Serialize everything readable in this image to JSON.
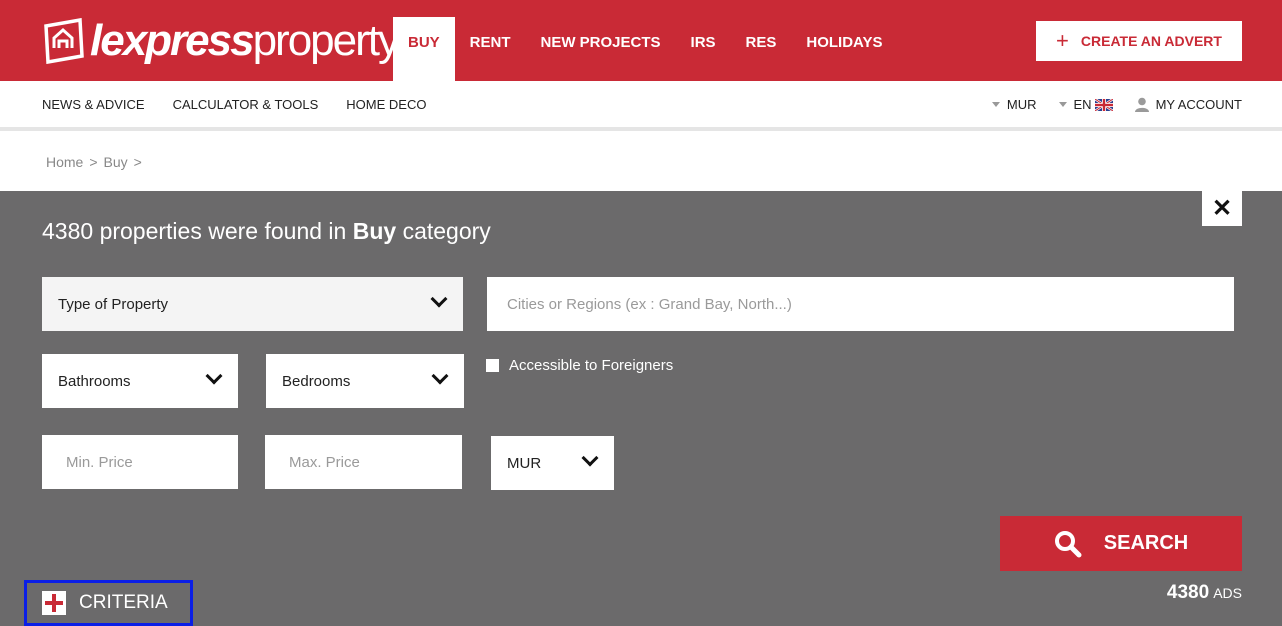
{
  "brand": {
    "logo_bold": "lexpress",
    "logo_light": "property",
    "accent_color": "#c92a36",
    "panel_color": "#6b6a6b"
  },
  "main_nav": [
    {
      "label": "BUY",
      "active": true
    },
    {
      "label": "RENT"
    },
    {
      "label": "NEW PROJECTS"
    },
    {
      "label": "IRS"
    },
    {
      "label": "RES"
    },
    {
      "label": "HOLIDAYS"
    }
  ],
  "create_advert": {
    "icon": "plus-icon",
    "label": "CREATE AN ADVERT"
  },
  "sub_nav": [
    {
      "label": "NEWS & ADVICE"
    },
    {
      "label": "CALCULATOR & TOOLS"
    },
    {
      "label": "HOME DECO"
    }
  ],
  "utility": {
    "currency": "MUR",
    "language": "EN",
    "account": "MY ACCOUNT"
  },
  "breadcrumb": {
    "items": [
      "Home",
      "Buy"
    ],
    "separator": ">"
  },
  "results": {
    "count": "4380",
    "text": "properties were found in",
    "category": "Buy",
    "suffix": "category"
  },
  "form": {
    "type_of_property": "Type of Property",
    "cities_placeholder": "Cities or Regions (ex : Grand Bay, North...)",
    "bathrooms": "Bathrooms",
    "bedrooms": "Bedrooms",
    "foreigners_label": "Accessible to Foreigners",
    "min_price_placeholder": "Min. Price",
    "max_price_placeholder": "Max. Price",
    "currency_select": "MUR",
    "search_label": "SEARCH",
    "search_icon": "search-icon",
    "close_icon": "close-icon"
  },
  "ads": {
    "count": "4380",
    "label": "ADS"
  },
  "criteria": {
    "label": "CRITERIA",
    "icon": "plus-icon"
  }
}
